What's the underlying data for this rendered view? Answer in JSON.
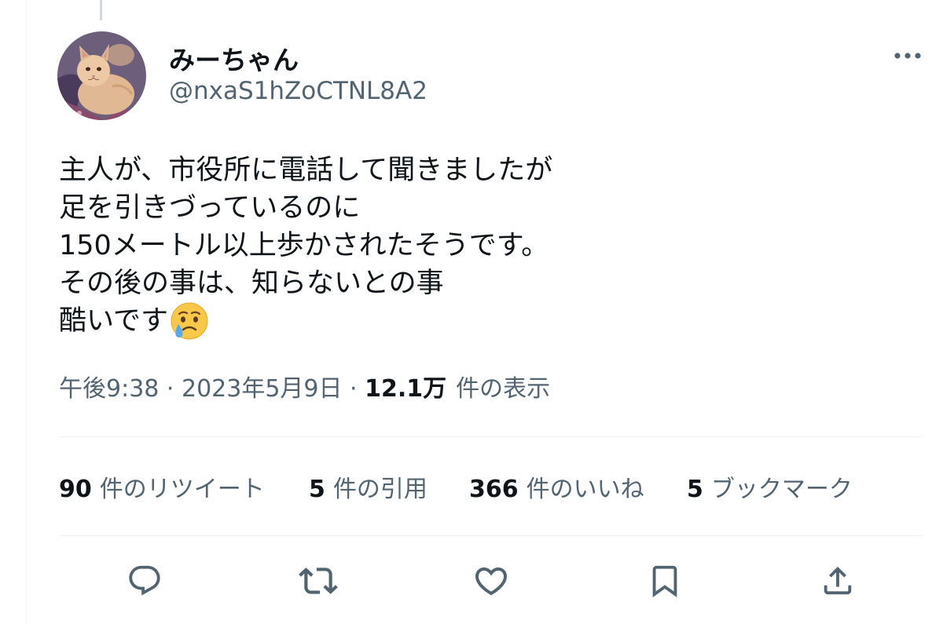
{
  "author": {
    "display_name": "みーちゃん",
    "handle": "@nxaS1hZoCTNL8A2",
    "avatar_icon": "cat-avatar"
  },
  "tweet": {
    "lines": [
      "主人が、市役所に電話して聞きましたが",
      "足を引きづっているのに",
      "150メートル以上歩かされたそうです。",
      "その後の事は、知らないとの事",
      "酷いです"
    ],
    "emoji": "crying-face-emoji"
  },
  "meta": {
    "time": "午後9:38",
    "separator": " · ",
    "date": "2023年5月9日",
    "views_count": "12.1万",
    "views_label": "件の表示"
  },
  "stats": {
    "retweets_count": "90",
    "retweets_label": "件のリツイート",
    "quotes_count": "5",
    "quotes_label": "件の引用",
    "likes_count": "366",
    "likes_label": "件のいいね",
    "bookmarks_count": "5",
    "bookmarks_label": "ブックマーク"
  },
  "actions": [
    "reply-icon",
    "retweet-icon",
    "like-icon",
    "bookmark-icon",
    "share-icon"
  ],
  "colors": {
    "text_primary": "#0f1419",
    "text_secondary": "#536471",
    "divider": "#eff3f4"
  }
}
